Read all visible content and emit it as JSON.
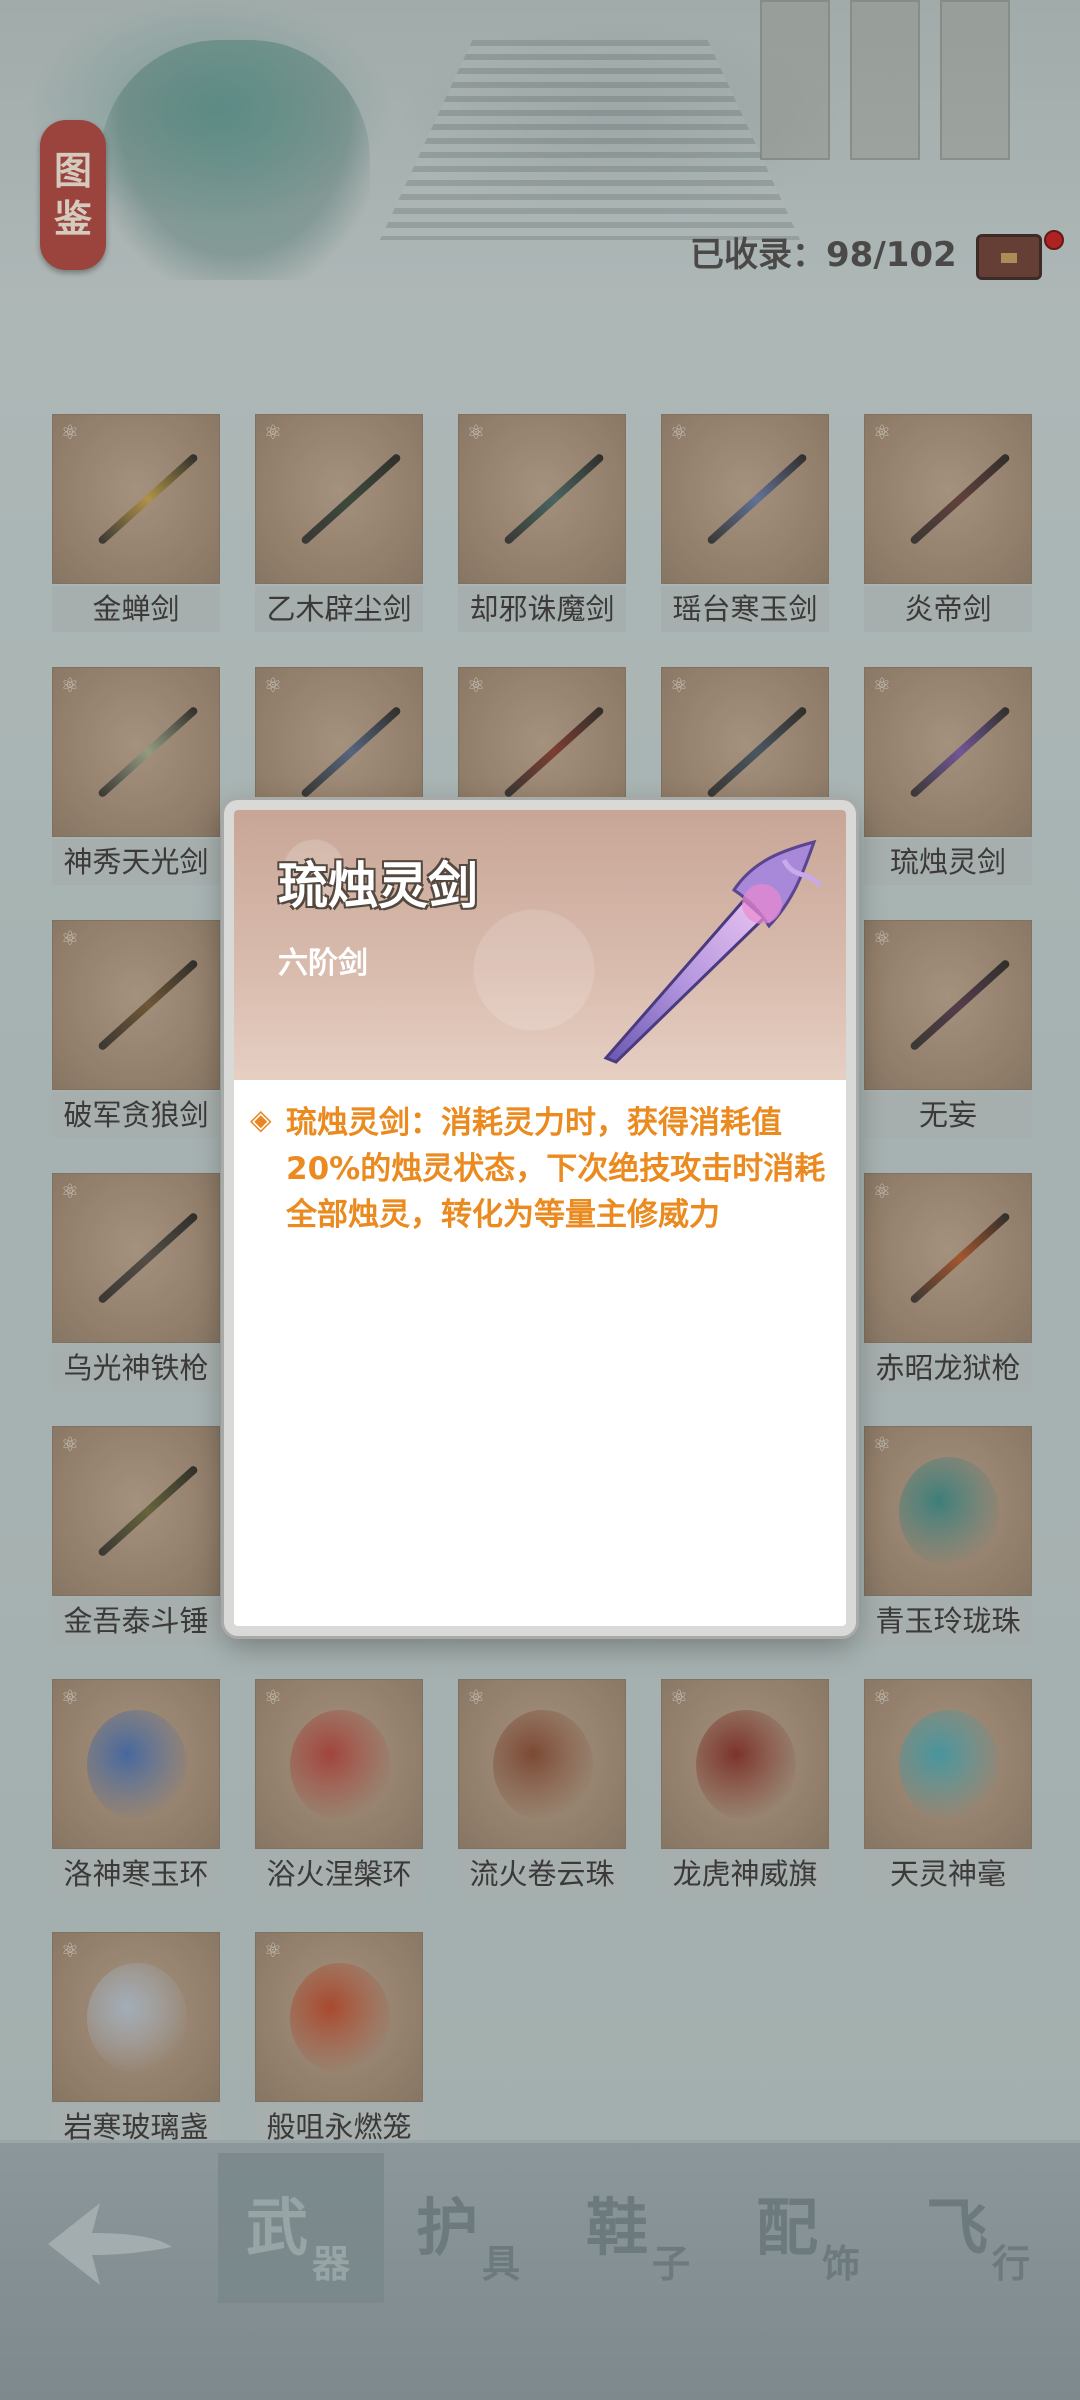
{
  "header": {
    "logo_text": [
      "图",
      "鉴"
    ],
    "collected_label": "已收录：98/102"
  },
  "items": [
    {
      "name": "金蝉剑",
      "color": "#c9a34a"
    },
    {
      "name": "乙木辟尘剑",
      "color": "#3e4a3a"
    },
    {
      "name": "却邪诛魔剑",
      "color": "#4d6b66"
    },
    {
      "name": "瑶台寒玉剑",
      "color": "#6b7ba6"
    },
    {
      "name": "炎帝剑",
      "color": "#6a3f3a"
    },
    {
      "name": "神秀天光剑",
      "color": "#a8ad8e"
    },
    {
      "name": "",
      "color": "#5c6b8a"
    },
    {
      "name": "",
      "color": "#8a3c2e"
    },
    {
      "name": "",
      "color": "#4e5a66"
    },
    {
      "name": "琉烛灵剑",
      "color": "#7c5aa6"
    },
    {
      "name": "破军贪狼剑",
      "color": "#7a5a33"
    },
    {
      "name": "",
      "color": "#6b5a4a"
    },
    {
      "name": "",
      "color": "#6b5a4a"
    },
    {
      "name": "",
      "color": "#6b5a4a"
    },
    {
      "name": "无妄",
      "color": "#5a3a4a"
    },
    {
      "name": "乌光神铁枪",
      "color": "#5a4f46"
    },
    {
      "name": "",
      "color": "#6b5a4a"
    },
    {
      "name": "",
      "color": "#6b5a4a"
    },
    {
      "name": "",
      "color": "#6b5a4a"
    },
    {
      "name": "赤昭龙狱枪",
      "color": "#b85a2a"
    },
    {
      "name": "金吾泰斗锤",
      "color": "#6e6a3a"
    },
    {
      "name": "",
      "color": "#6b5a4a"
    },
    {
      "name": "",
      "color": "#6b5a4a"
    },
    {
      "name": "",
      "color": "#6b5a4a"
    },
    {
      "name": "青玉玲珑珠",
      "color": "#3f8a86"
    },
    {
      "name": "洛神寒玉环",
      "color": "#4a6fb0"
    },
    {
      "name": "浴火涅槃环",
      "color": "#b8443a"
    },
    {
      "name": "流火卷云珠",
      "color": "#8a4a30"
    },
    {
      "name": "龙虎神威旗",
      "color": "#8a2f25"
    },
    {
      "name": "天灵神毫",
      "color": "#4aa6b0"
    },
    {
      "name": "岩寒玻璃盏",
      "color": "#b9c3d0"
    },
    {
      "name": "般咀永燃笼",
      "color": "#c04a2a"
    }
  ],
  "modal": {
    "title": "琉烛灵剑",
    "subtitle": "六阶剑",
    "description": "琉烛灵剑：消耗灵力时，获得消耗值20%的烛灵状态，下次绝技攻击时消耗全部烛灵，转化为等量主修威力",
    "accent_color": "#ea8a1f"
  },
  "tabs": [
    {
      "big": "武",
      "small": "器",
      "active": true
    },
    {
      "big": "护",
      "small": "具",
      "active": false
    },
    {
      "big": "鞋",
      "small": "子",
      "active": false
    },
    {
      "big": "配",
      "small": "饰",
      "active": false
    },
    {
      "big": "飞",
      "small": "行",
      "active": false
    }
  ]
}
